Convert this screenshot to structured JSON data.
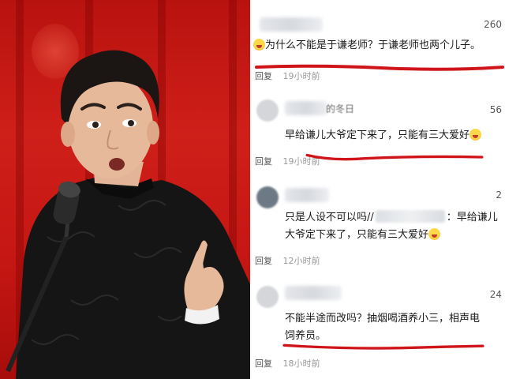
{
  "colors": {
    "stage_red": "#c41613",
    "robe": "#151515",
    "annotation_red": "#d0151a",
    "text": "#1a1a1a",
    "meta": "#777777"
  },
  "photo": {
    "subject": "performer-speaking-at-microphone"
  },
  "comments": [
    {
      "likes": "260",
      "emoji_icon": "crying-laughing-emoji",
      "text": "为什么不能是于谦老师？于谦老师也两个儿子。",
      "reply_label": "回复",
      "time": "19小时前",
      "underlined": true
    },
    {
      "likes": "56",
      "name_partial": "的冬日",
      "text": "早给谦儿大爷定下来了，只能有三大爱好",
      "emoji_icon": "laughing-emoji",
      "reply_label": "回复",
      "time": "19小时前",
      "underlined": true
    },
    {
      "likes": "2",
      "text_before": "只是人设不可以吗//",
      "text_after": "：早给谦儿",
      "text_line2": "大爷定下来了，只能有三大爱好",
      "emoji_icon": "laughing-emoji",
      "reply_label": "回复",
      "time": "12小时前",
      "underlined": false
    },
    {
      "likes": "24",
      "text_line1": "不能半途而改吗？抽烟喝酒养小三，相声电",
      "text_line2": "饲养员。",
      "reply_label": "回复",
      "time": "18小时前",
      "underlined": true
    }
  ]
}
